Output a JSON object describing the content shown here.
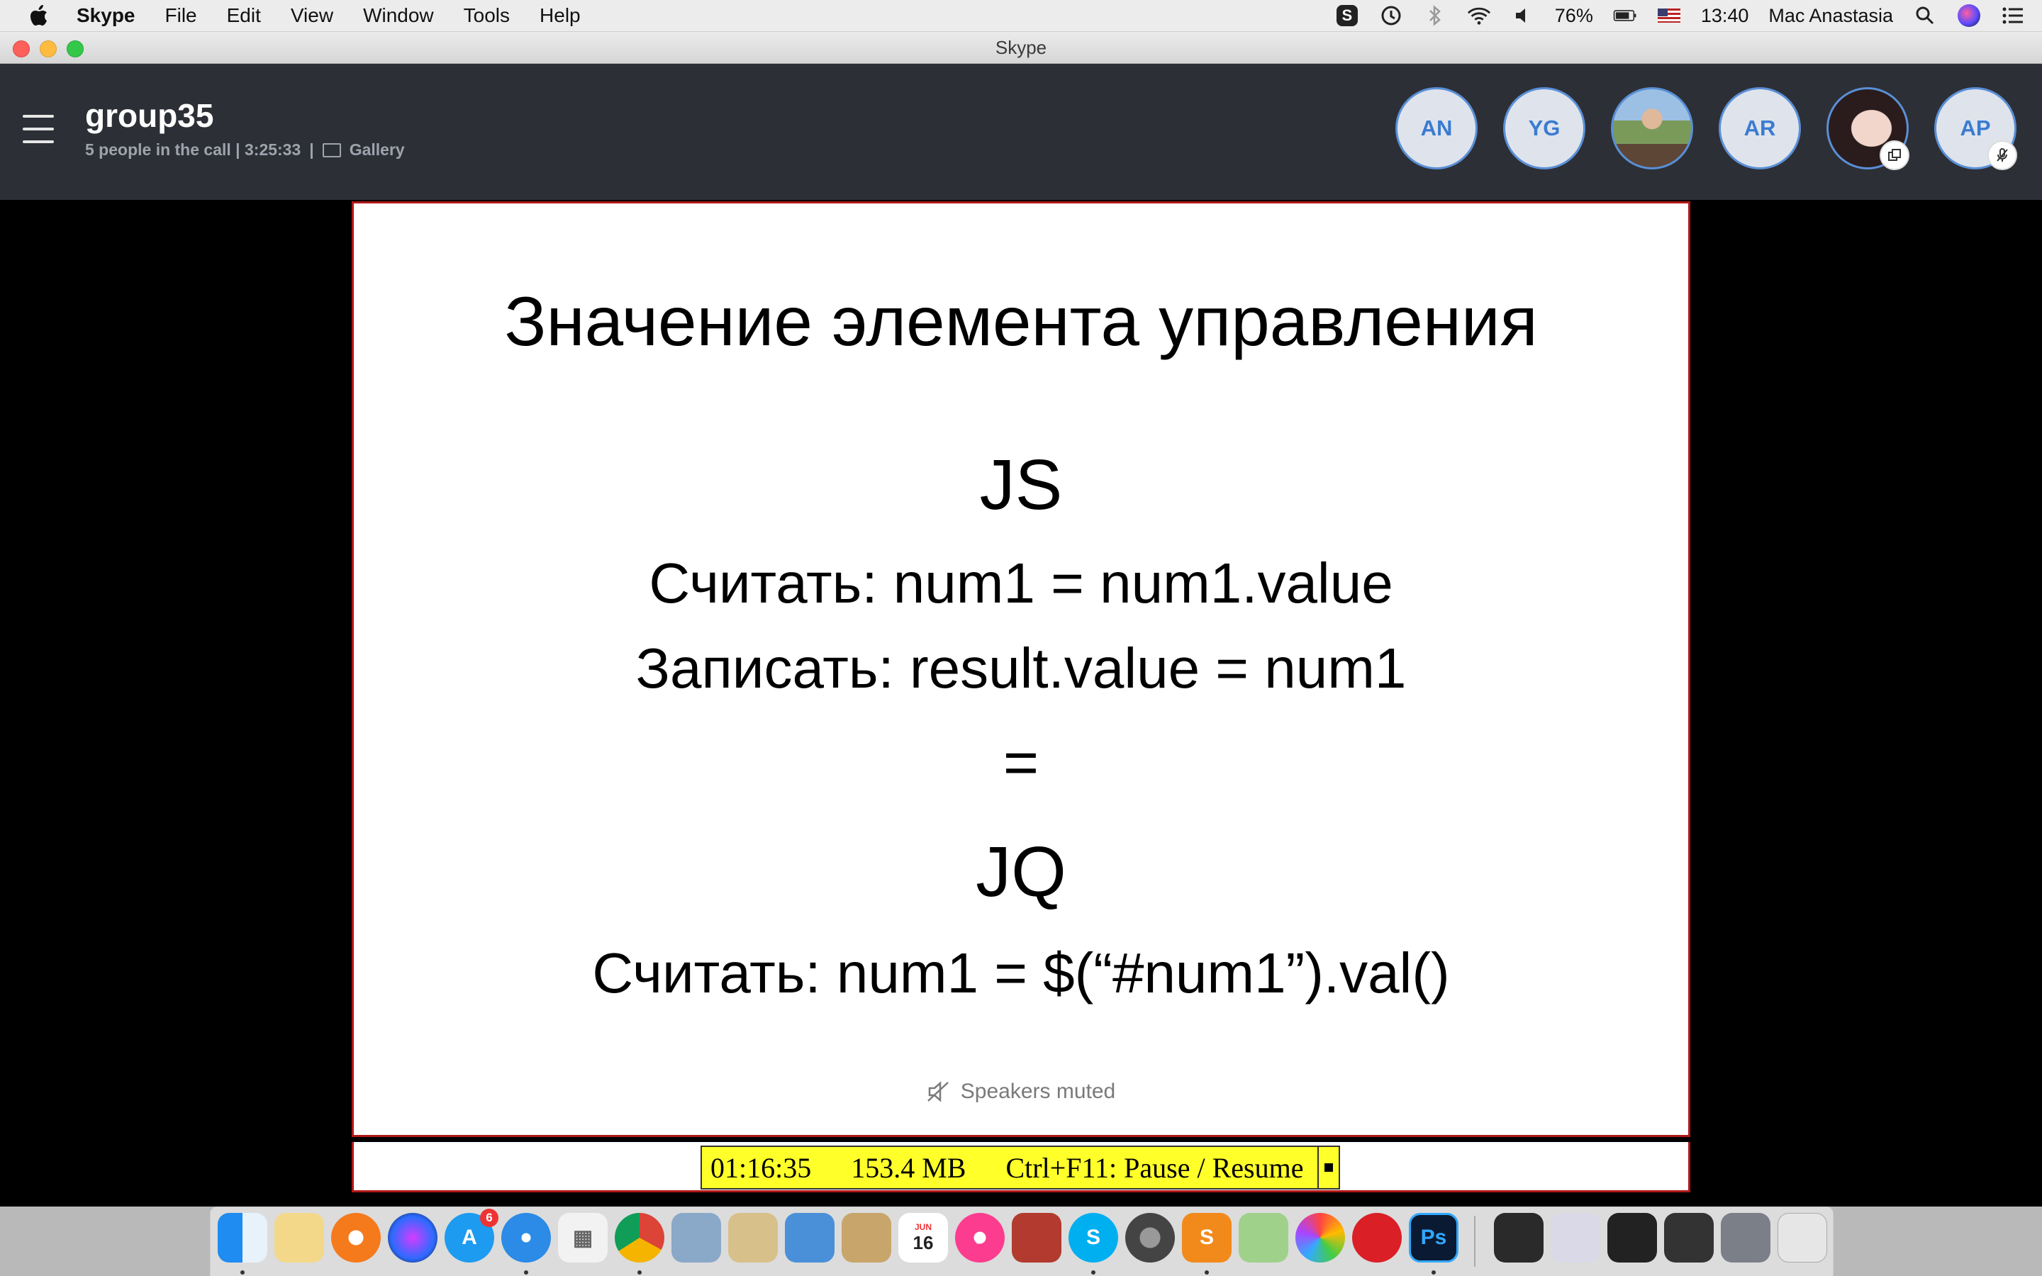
{
  "menubar": {
    "app_name": "Skype",
    "items": [
      "File",
      "Edit",
      "View",
      "Window",
      "Tools",
      "Help"
    ],
    "battery": "76%",
    "time": "13:40",
    "user": "Mac Anastasia"
  },
  "window": {
    "title": "Skype"
  },
  "call": {
    "group_name": "group35",
    "people_in_call": "5 people in the call | 3:25:33",
    "separator": "|",
    "view_mode": "Gallery",
    "participants": [
      {
        "initials": "AN",
        "type": "initials"
      },
      {
        "initials": "YG",
        "type": "initials"
      },
      {
        "initials": "",
        "type": "photo"
      },
      {
        "initials": "AR",
        "type": "initials"
      },
      {
        "initials": "",
        "type": "photo"
      },
      {
        "initials": "AP",
        "type": "initials",
        "muted": true
      }
    ]
  },
  "slide": {
    "title": "Значение элемента управления",
    "js_heading": "JS",
    "js_read": "Считать: num1 = num1.value",
    "js_write": "Записать: result.value = num1",
    "equals": "=",
    "jq_heading": "JQ",
    "jq_read": "Считать: num1 = $(“#num1”).val()"
  },
  "status": {
    "speakers_muted": "Speakers muted"
  },
  "recorder": {
    "elapsed": "01:16:35",
    "size": "153.4 MB",
    "hotkey": "Ctrl+F11: Pause / Resume"
  },
  "dock": {
    "calendar_month": "JUN",
    "calendar_day": "16",
    "appstore_badge": "6"
  },
  "colors": {
    "header_bg": "#2c2f36",
    "avatar_text": "#3b7bd1",
    "slide_border": "#b01818",
    "recorder_bg": "#ffff2a"
  }
}
